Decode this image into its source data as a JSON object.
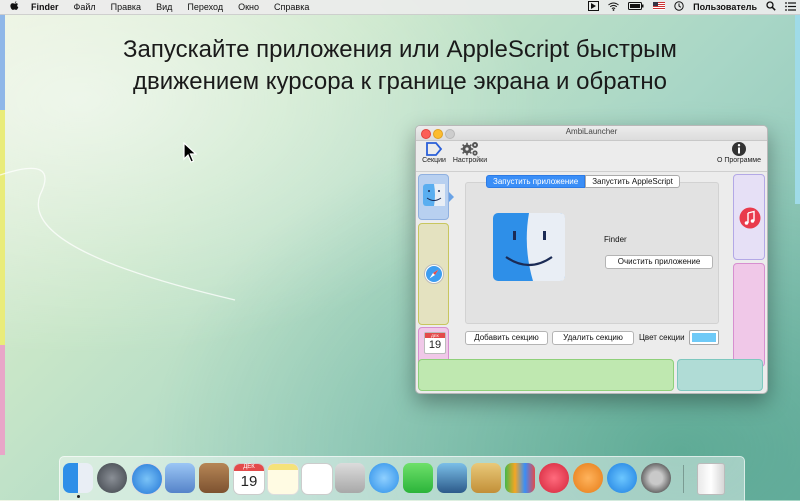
{
  "menubar": {
    "apple": "",
    "app_name": "Finder",
    "items": [
      "Файл",
      "Правка",
      "Вид",
      "Переход",
      "Окно",
      "Справка"
    ],
    "user": "Пользователь"
  },
  "headline": {
    "line1": "Запускайте приложения или AppleScript быстрым",
    "line2": "движением курсора к границе экрана и обратно"
  },
  "window": {
    "title": "AmbiLauncher",
    "toolbar": {
      "sections": "Секции",
      "settings": "Настройки",
      "about": "О Программе"
    },
    "tabs": {
      "launch_app": "Запустить приложение",
      "launch_script": "Запустить AppleScript"
    },
    "app_name": "Finder",
    "clear_app": "Очистить приложение",
    "add_section": "Добавить секцию",
    "delete_section": "Удалить секцию",
    "section_color_label": "Цвет секции",
    "section_color": "#6fcaf7"
  },
  "colors": {
    "blue_section": "#b8d0f0",
    "yellow_section": "#e4e2c0",
    "pink_section": "#f0c8e8",
    "green_section": "#bfe8b0",
    "teal_section": "#b0dcd6"
  },
  "dock": {
    "apps": [
      "finder",
      "launchpad",
      "safari",
      "mail-stamp",
      "contacts",
      "calendar",
      "notes",
      "reminders",
      "photo-preview",
      "messages",
      "facetime",
      "photo-booth",
      "preview",
      "numbers",
      "itunes",
      "ibooks",
      "app-store",
      "system-preferences",
      "trash"
    ],
    "calendar_day": "19",
    "calendar_month": "ДЕК"
  }
}
